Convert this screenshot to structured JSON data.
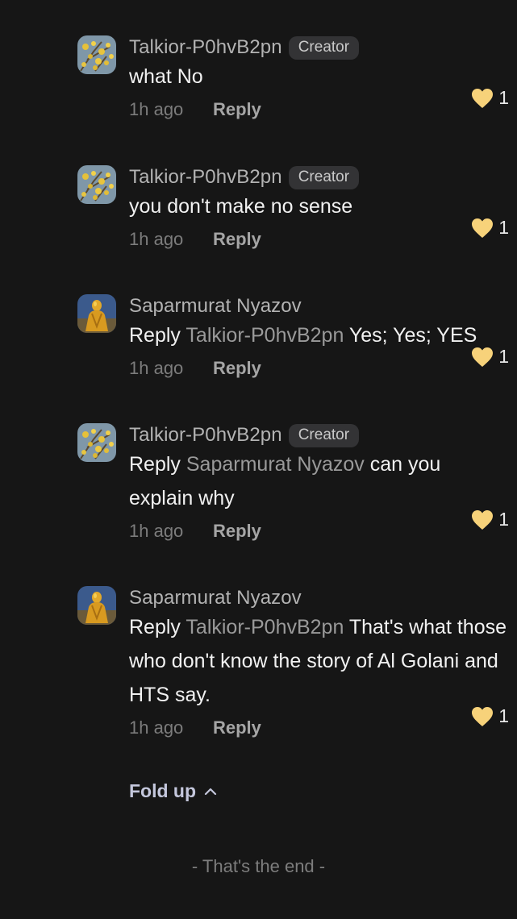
{
  "comments": [
    {
      "avatar": "yellow-flowers-avatar",
      "name": "Talkior-P0hvB2pn",
      "badge": "Creator",
      "prefix": "",
      "mention": "",
      "text": "what No",
      "time": "1h ago",
      "reply": "Reply",
      "likes": "1"
    },
    {
      "avatar": "yellow-flowers-avatar",
      "name": "Talkior-P0hvB2pn",
      "badge": "Creator",
      "prefix": "",
      "mention": "",
      "text": "you don't make no sense",
      "time": "1h ago",
      "reply": "Reply",
      "likes": "1"
    },
    {
      "avatar": "golden-statue-avatar",
      "name": "Saparmurat Nyazov",
      "badge": "",
      "prefix": "Reply ",
      "mention": "Talkior-P0hvB2pn",
      "text": " Yes; Yes; YES",
      "time": "1h ago",
      "reply": "Reply",
      "likes": "1"
    },
    {
      "avatar": "yellow-flowers-avatar",
      "name": "Talkior-P0hvB2pn",
      "badge": "Creator",
      "prefix": "Reply ",
      "mention": "Saparmurat Nyazov",
      "text": " can you explain why",
      "time": "1h ago",
      "reply": "Reply",
      "likes": "1"
    },
    {
      "avatar": "golden-statue-avatar",
      "name": "Saparmurat Nyazov",
      "badge": "",
      "prefix": "Reply ",
      "mention": "Talkior-P0hvB2pn",
      "text": " That's what those who don't know the story of Al Golani and HTS say.",
      "time": "1h ago",
      "reply": "Reply",
      "likes": "1"
    }
  ],
  "fold_up": "Fold up",
  "end_text": "- That's the end -",
  "colors": {
    "background": "#161616",
    "heart": "#f7d27a",
    "mention": "#9a9a9a",
    "fold_up": "#c4c7dc"
  }
}
